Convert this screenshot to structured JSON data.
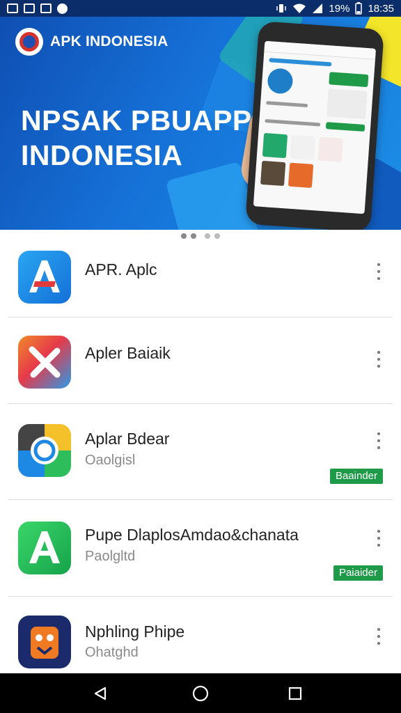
{
  "status_bar": {
    "battery": "19%",
    "time": "18:35"
  },
  "banner": {
    "brand": "APK INDONESIA",
    "headline_line1": "NPSAK PBUAPP",
    "headline_line2": "INDONESIA"
  },
  "apps": [
    {
      "name": "APR. Aplc",
      "subtitle": "",
      "badge": ""
    },
    {
      "name": "Apler Baiaik",
      "subtitle": "",
      "badge": ""
    },
    {
      "name": "Aplar Bdear",
      "subtitle": "Oaolgisl",
      "badge": "Baainder"
    },
    {
      "name": "Pupe DlaplosAmdao&chanata",
      "subtitle": "Paolgltd",
      "badge": "Paiaider"
    },
    {
      "name": "Nphling Phipe",
      "subtitle": "Ohatghd",
      "badge": ""
    }
  ],
  "icons": {
    "status_left": [
      "image-icon",
      "photo-icon",
      "gallery-icon",
      "media-icon"
    ],
    "status_right": [
      "vibrate-icon",
      "wifi-icon",
      "signal-icon",
      "battery-icon"
    ],
    "nav": [
      "back-icon",
      "home-icon",
      "recents-icon"
    ],
    "row_menu": "more-vertical-icon"
  },
  "colors": {
    "banner_blue": "#1672d8",
    "badge_green": "#1e9a48",
    "status_bar": "#0b2e6a"
  }
}
